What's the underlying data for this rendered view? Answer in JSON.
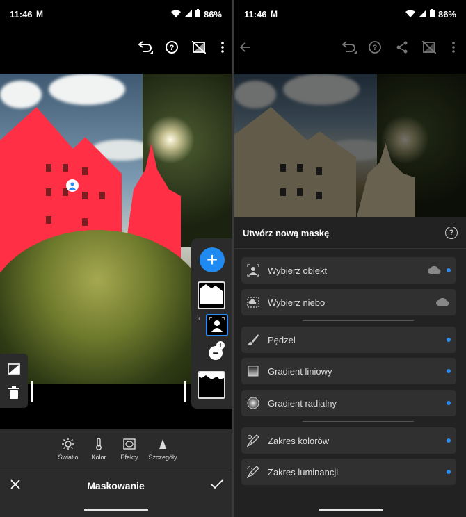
{
  "status": {
    "time": "11:46",
    "battery": "86%"
  },
  "left": {
    "bottom_tabs": [
      {
        "label": "Światło",
        "icon": "sun-icon"
      },
      {
        "label": "Kolor",
        "icon": "thermometer-icon"
      },
      {
        "label": "Efekty",
        "icon": "vignette-icon"
      },
      {
        "label": "Szczegóły",
        "icon": "triangle-icon"
      }
    ],
    "action_bar": {
      "title": "Maskowanie"
    }
  },
  "right": {
    "sheet": {
      "title": "Utwórz nową maskę",
      "help": "?",
      "options": [
        {
          "label": "Wybierz obiekt",
          "icon": "select-subject-icon",
          "cloud": true,
          "dot": true
        },
        {
          "label": "Wybierz niebo",
          "icon": "select-sky-icon",
          "cloud": true,
          "dot": false
        },
        {
          "label": "Pędzel",
          "icon": "brush-icon",
          "cloud": false,
          "dot": true
        },
        {
          "label": "Gradient liniowy",
          "icon": "linear-gradient-icon",
          "cloud": false,
          "dot": true
        },
        {
          "label": "Gradient radialny",
          "icon": "radial-gradient-icon",
          "cloud": false,
          "dot": true
        },
        {
          "label": "Zakres kolorów",
          "icon": "color-range-icon",
          "cloud": false,
          "dot": true
        },
        {
          "label": "Zakres luminancji",
          "icon": "luminance-range-icon",
          "cloud": false,
          "dot": true
        }
      ]
    }
  },
  "colors": {
    "accent": "#2a8cf0",
    "mask": "#ff2f45"
  }
}
